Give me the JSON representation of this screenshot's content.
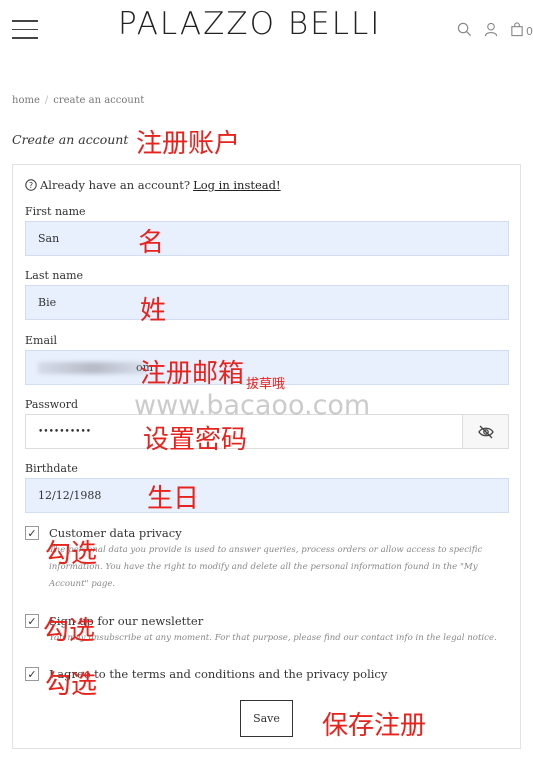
{
  "header": {
    "logo": "PALAZZO BELLI",
    "icons": [
      "menu-icon",
      "search-icon",
      "user-icon",
      "cart-icon"
    ],
    "cart_count": "0"
  },
  "breadcrumb": {
    "home": "home",
    "sep": "/",
    "current": "create an account"
  },
  "page_title": "Create an account",
  "form": {
    "already_text": "Already have an account?",
    "login_link": "Log in instead!",
    "first_name": {
      "label": "First name",
      "value": "San"
    },
    "last_name": {
      "label": "Last name",
      "value": "Bie"
    },
    "email": {
      "label": "Email",
      "value": "om"
    },
    "password": {
      "label": "Password",
      "value": "••••••••••"
    },
    "birthdate": {
      "label": "Birthdate",
      "value": "12/12/1988"
    },
    "privacy": {
      "label": "Customer data privacy",
      "help": "The personal data you provide is used to answer queries, process orders or allow access to specific information. You have the right to modify and delete all the personal information found in the \"My Account\" page."
    },
    "newsletter": {
      "label": "Sign up for our newsletter",
      "help": "You may unsubscribe at any moment. For that purpose, please find our contact info in the legal notice."
    },
    "terms": {
      "label": "I agree to the terms and conditions and the privacy policy"
    },
    "checkmark": "✓",
    "save": "Save"
  },
  "annotations": {
    "title": "注册账户",
    "first_name": "名",
    "last_name": "姓",
    "email": "注册邮箱",
    "email_small": "拔草哦",
    "password": "设置密码",
    "birthdate": "生日",
    "check1": "勾选",
    "check2": "勾选",
    "check3": "勾选",
    "save": "保存注册"
  },
  "watermark": "www.bacaoo.com",
  "colors": {
    "annotation": "#e8221c",
    "autofill": "#e8f0fe"
  }
}
